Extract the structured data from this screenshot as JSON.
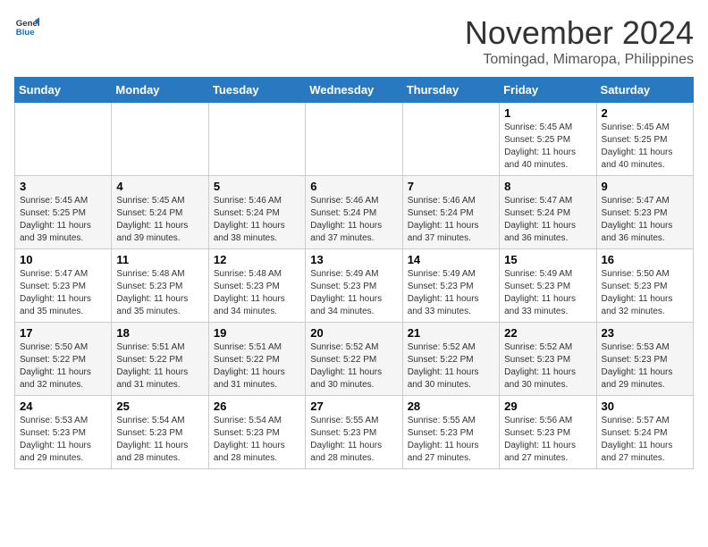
{
  "header": {
    "logo_line1": "General",
    "logo_line2": "Blue",
    "month": "November 2024",
    "location": "Tomingad, Mimaropa, Philippines"
  },
  "weekdays": [
    "Sunday",
    "Monday",
    "Tuesday",
    "Wednesday",
    "Thursday",
    "Friday",
    "Saturday"
  ],
  "weeks": [
    [
      {
        "day": "",
        "info": ""
      },
      {
        "day": "",
        "info": ""
      },
      {
        "day": "",
        "info": ""
      },
      {
        "day": "",
        "info": ""
      },
      {
        "day": "",
        "info": ""
      },
      {
        "day": "1",
        "info": "Sunrise: 5:45 AM\nSunset: 5:25 PM\nDaylight: 11 hours and 40 minutes."
      },
      {
        "day": "2",
        "info": "Sunrise: 5:45 AM\nSunset: 5:25 PM\nDaylight: 11 hours and 40 minutes."
      }
    ],
    [
      {
        "day": "3",
        "info": "Sunrise: 5:45 AM\nSunset: 5:25 PM\nDaylight: 11 hours and 39 minutes."
      },
      {
        "day": "4",
        "info": "Sunrise: 5:45 AM\nSunset: 5:24 PM\nDaylight: 11 hours and 39 minutes."
      },
      {
        "day": "5",
        "info": "Sunrise: 5:46 AM\nSunset: 5:24 PM\nDaylight: 11 hours and 38 minutes."
      },
      {
        "day": "6",
        "info": "Sunrise: 5:46 AM\nSunset: 5:24 PM\nDaylight: 11 hours and 37 minutes."
      },
      {
        "day": "7",
        "info": "Sunrise: 5:46 AM\nSunset: 5:24 PM\nDaylight: 11 hours and 37 minutes."
      },
      {
        "day": "8",
        "info": "Sunrise: 5:47 AM\nSunset: 5:24 PM\nDaylight: 11 hours and 36 minutes."
      },
      {
        "day": "9",
        "info": "Sunrise: 5:47 AM\nSunset: 5:23 PM\nDaylight: 11 hours and 36 minutes."
      }
    ],
    [
      {
        "day": "10",
        "info": "Sunrise: 5:47 AM\nSunset: 5:23 PM\nDaylight: 11 hours and 35 minutes."
      },
      {
        "day": "11",
        "info": "Sunrise: 5:48 AM\nSunset: 5:23 PM\nDaylight: 11 hours and 35 minutes."
      },
      {
        "day": "12",
        "info": "Sunrise: 5:48 AM\nSunset: 5:23 PM\nDaylight: 11 hours and 34 minutes."
      },
      {
        "day": "13",
        "info": "Sunrise: 5:49 AM\nSunset: 5:23 PM\nDaylight: 11 hours and 34 minutes."
      },
      {
        "day": "14",
        "info": "Sunrise: 5:49 AM\nSunset: 5:23 PM\nDaylight: 11 hours and 33 minutes."
      },
      {
        "day": "15",
        "info": "Sunrise: 5:49 AM\nSunset: 5:23 PM\nDaylight: 11 hours and 33 minutes."
      },
      {
        "day": "16",
        "info": "Sunrise: 5:50 AM\nSunset: 5:23 PM\nDaylight: 11 hours and 32 minutes."
      }
    ],
    [
      {
        "day": "17",
        "info": "Sunrise: 5:50 AM\nSunset: 5:22 PM\nDaylight: 11 hours and 32 minutes."
      },
      {
        "day": "18",
        "info": "Sunrise: 5:51 AM\nSunset: 5:22 PM\nDaylight: 11 hours and 31 minutes."
      },
      {
        "day": "19",
        "info": "Sunrise: 5:51 AM\nSunset: 5:22 PM\nDaylight: 11 hours and 31 minutes."
      },
      {
        "day": "20",
        "info": "Sunrise: 5:52 AM\nSunset: 5:22 PM\nDaylight: 11 hours and 30 minutes."
      },
      {
        "day": "21",
        "info": "Sunrise: 5:52 AM\nSunset: 5:22 PM\nDaylight: 11 hours and 30 minutes."
      },
      {
        "day": "22",
        "info": "Sunrise: 5:52 AM\nSunset: 5:23 PM\nDaylight: 11 hours and 30 minutes."
      },
      {
        "day": "23",
        "info": "Sunrise: 5:53 AM\nSunset: 5:23 PM\nDaylight: 11 hours and 29 minutes."
      }
    ],
    [
      {
        "day": "24",
        "info": "Sunrise: 5:53 AM\nSunset: 5:23 PM\nDaylight: 11 hours and 29 minutes."
      },
      {
        "day": "25",
        "info": "Sunrise: 5:54 AM\nSunset: 5:23 PM\nDaylight: 11 hours and 28 minutes."
      },
      {
        "day": "26",
        "info": "Sunrise: 5:54 AM\nSunset: 5:23 PM\nDaylight: 11 hours and 28 minutes."
      },
      {
        "day": "27",
        "info": "Sunrise: 5:55 AM\nSunset: 5:23 PM\nDaylight: 11 hours and 28 minutes."
      },
      {
        "day": "28",
        "info": "Sunrise: 5:55 AM\nSunset: 5:23 PM\nDaylight: 11 hours and 27 minutes."
      },
      {
        "day": "29",
        "info": "Sunrise: 5:56 AM\nSunset: 5:23 PM\nDaylight: 11 hours and 27 minutes."
      },
      {
        "day": "30",
        "info": "Sunrise: 5:57 AM\nSunset: 5:24 PM\nDaylight: 11 hours and 27 minutes."
      }
    ]
  ]
}
